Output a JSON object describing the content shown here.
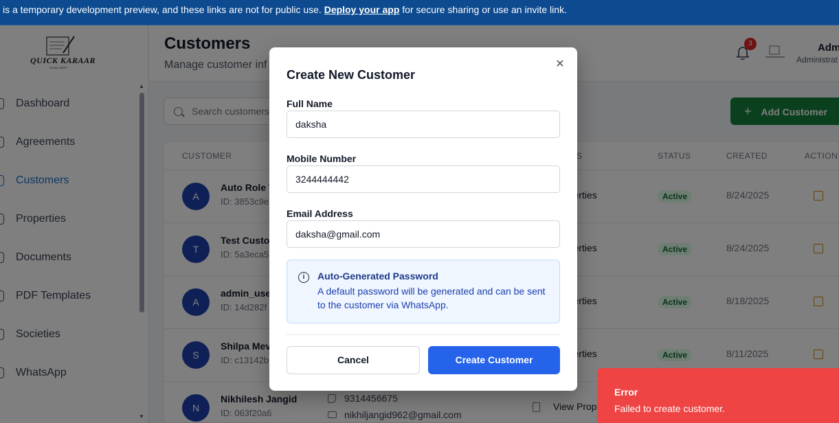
{
  "banner": {
    "text_before": "is a temporary development preview, and these links are not for public use.",
    "link": "Deploy your app",
    "text_after": "for secure sharing or use an invite link."
  },
  "logo": {
    "text": "QUICK KARAAR",
    "sub": "LEGAL DRAFT"
  },
  "sidebar": {
    "items": [
      {
        "label": "Dashboard",
        "icon": "home-icon",
        "active": false
      },
      {
        "label": "Agreements",
        "icon": "pen-icon",
        "active": false
      },
      {
        "label": "Customers",
        "icon": "users-icon",
        "active": true
      },
      {
        "label": "Properties",
        "icon": "map-pin-icon",
        "active": false
      },
      {
        "label": "Documents",
        "icon": "folder-icon",
        "active": false
      },
      {
        "label": "PDF Templates",
        "icon": "file-icon",
        "active": false
      },
      {
        "label": "Societies",
        "icon": "building-icon",
        "active": false
      },
      {
        "label": "WhatsApp",
        "icon": "chat-icon",
        "active": false
      }
    ]
  },
  "header": {
    "title": "Customers",
    "subtitle": "Manage customer inf",
    "notification_count": "3",
    "user_name": "Adm",
    "user_role": "Administrat"
  },
  "search": {
    "placeholder": "Search customers"
  },
  "add_button": {
    "label": "Add Customer"
  },
  "table": {
    "headers": {
      "customer": "CUSTOMER",
      "properties": "S",
      "status": "STATUS",
      "created": "CREATED",
      "actions": "ACTION"
    },
    "rows": [
      {
        "initial": "A",
        "name": "Auto Role T",
        "id": "ID: 3853c9e",
        "properties": "Properties",
        "status": "Active",
        "created": "8/24/2025"
      },
      {
        "initial": "T",
        "name": "Test Custon",
        "id": "ID: 5a3eca5",
        "properties": "Properties",
        "status": "Active",
        "created": "8/24/2025"
      },
      {
        "initial": "A",
        "name": "admin_user",
        "id": "ID: 14d282f",
        "properties": "Properties",
        "status": "Active",
        "created": "8/18/2025"
      },
      {
        "initial": "S",
        "name": "Shilpa Mev",
        "id": "ID: c13142b",
        "properties": "Properties",
        "status": "Active",
        "created": "8/11/2025"
      },
      {
        "initial": "N",
        "name": "Nikhilesh Jangid",
        "id": "ID: 063f20a6",
        "phone": "9314456675",
        "email": "nikhiljangid962@gmail.com",
        "properties": "View Prop"
      }
    ]
  },
  "modal": {
    "title": "Create New Customer",
    "full_name_label": "Full Name",
    "full_name_value": "daksha",
    "mobile_label": "Mobile Number",
    "mobile_value": "3244444442",
    "email_label": "Email Address",
    "email_value": "daksha@gmail.com",
    "info_title": "Auto-Generated Password",
    "info_text": "A default password will be generated and can be sent to the customer via WhatsApp.",
    "cancel_label": "Cancel",
    "create_label": "Create Customer"
  },
  "toast": {
    "title": "Error",
    "message": "Failed to create customer."
  },
  "colors": {
    "primary": "#2563eb",
    "success": "#15803d",
    "error": "#ef4444",
    "banner": "#0d4a8f"
  }
}
